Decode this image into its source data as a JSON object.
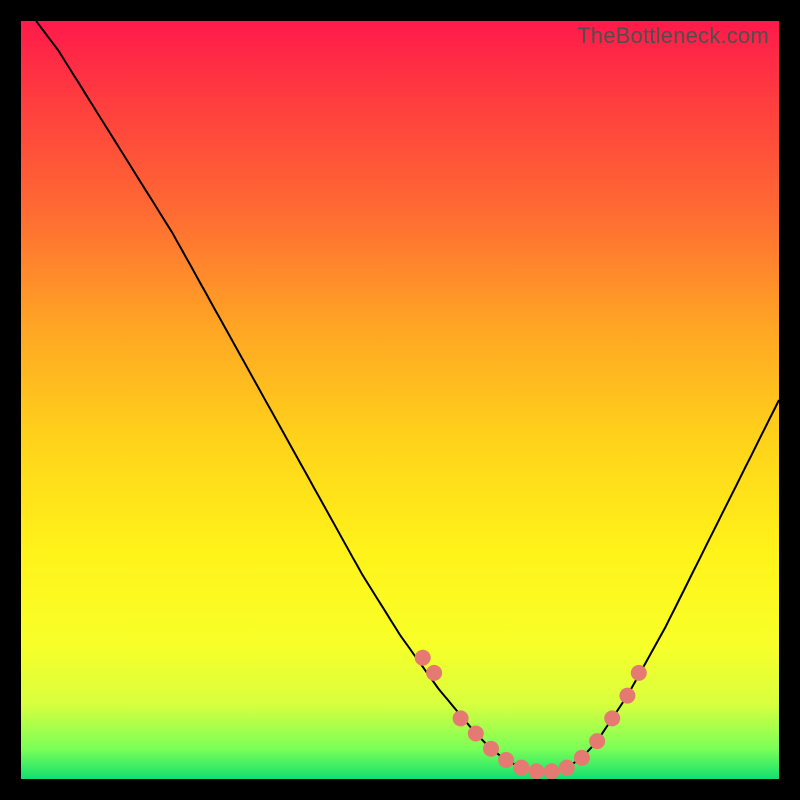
{
  "watermark": "TheBottleneck.com",
  "chart_data": {
    "type": "line",
    "title": "",
    "xlabel": "",
    "ylabel": "",
    "xlim": [
      0,
      100
    ],
    "ylim": [
      0,
      100
    ],
    "grid": false,
    "series": [
      {
        "name": "bottleneck-curve",
        "x": [
          2,
          5,
          10,
          15,
          20,
          25,
          30,
          35,
          40,
          45,
          50,
          55,
          60,
          62,
          64,
          66,
          68,
          70,
          72,
          74,
          76,
          80,
          85,
          90,
          95,
          100
        ],
        "y": [
          100,
          96,
          88,
          80,
          72,
          63,
          54,
          45,
          36,
          27,
          19,
          12,
          6,
          4,
          2.5,
          1.5,
          1,
          1,
          1.5,
          2.8,
          5,
          11,
          20,
          30,
          40,
          50
        ]
      }
    ],
    "markers": {
      "name": "highlight-points",
      "x": [
        53,
        54.5,
        58,
        60,
        62,
        64,
        66,
        68,
        70,
        72,
        74,
        76,
        78,
        80,
        81.5
      ],
      "y": [
        16,
        14,
        8,
        6,
        4,
        2.5,
        1.5,
        1,
        1,
        1.5,
        2.8,
        5,
        8,
        11,
        14
      ]
    },
    "colors": {
      "top": "#ff1a4b",
      "mid": "#ffd21a",
      "bottom": "#12e06f",
      "curve": "#000000",
      "marker": "#e47a71"
    }
  }
}
